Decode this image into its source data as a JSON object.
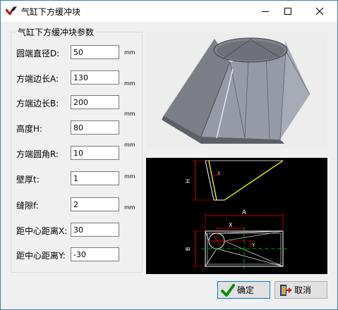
{
  "window": {
    "title": "气缸下方缓冲块",
    "controls": [
      "minimize",
      "maximize",
      "close"
    ]
  },
  "params": {
    "group_title": "气缸下方缓冲块参数",
    "items": [
      {
        "label": "圆端直径D:",
        "value": "50",
        "unit": "mm"
      },
      {
        "label": "方端边长A:",
        "value": "130",
        "unit": "mm"
      },
      {
        "label": "方端边长B:",
        "value": "200",
        "unit": "mm"
      },
      {
        "label": "高度H:",
        "value": "80",
        "unit": "mm"
      },
      {
        "label": "方端圆角R:",
        "value": "10",
        "unit": "mm"
      },
      {
        "label": "壁厚t:",
        "value": "1",
        "unit": "mm"
      },
      {
        "label": "缝隙f:",
        "value": "2",
        "unit": "mm"
      },
      {
        "label": "距中心距离X:",
        "value": "30",
        "unit": ""
      },
      {
        "label": "距中心距离Y:",
        "value": "-30",
        "unit": ""
      }
    ]
  },
  "drawing": {
    "labels": {
      "h": "H",
      "t": "t",
      "a": "A",
      "x": "X",
      "b": "B",
      "y": "Y"
    },
    "colors": {
      "background": "#000000",
      "outline": "#ffffff",
      "dimension": "#ff0000",
      "cone_edge": "#ffff00",
      "centerline": "#00cc00"
    }
  },
  "buttons": {
    "ok_label": "确定",
    "cancel_label": "取消"
  }
}
